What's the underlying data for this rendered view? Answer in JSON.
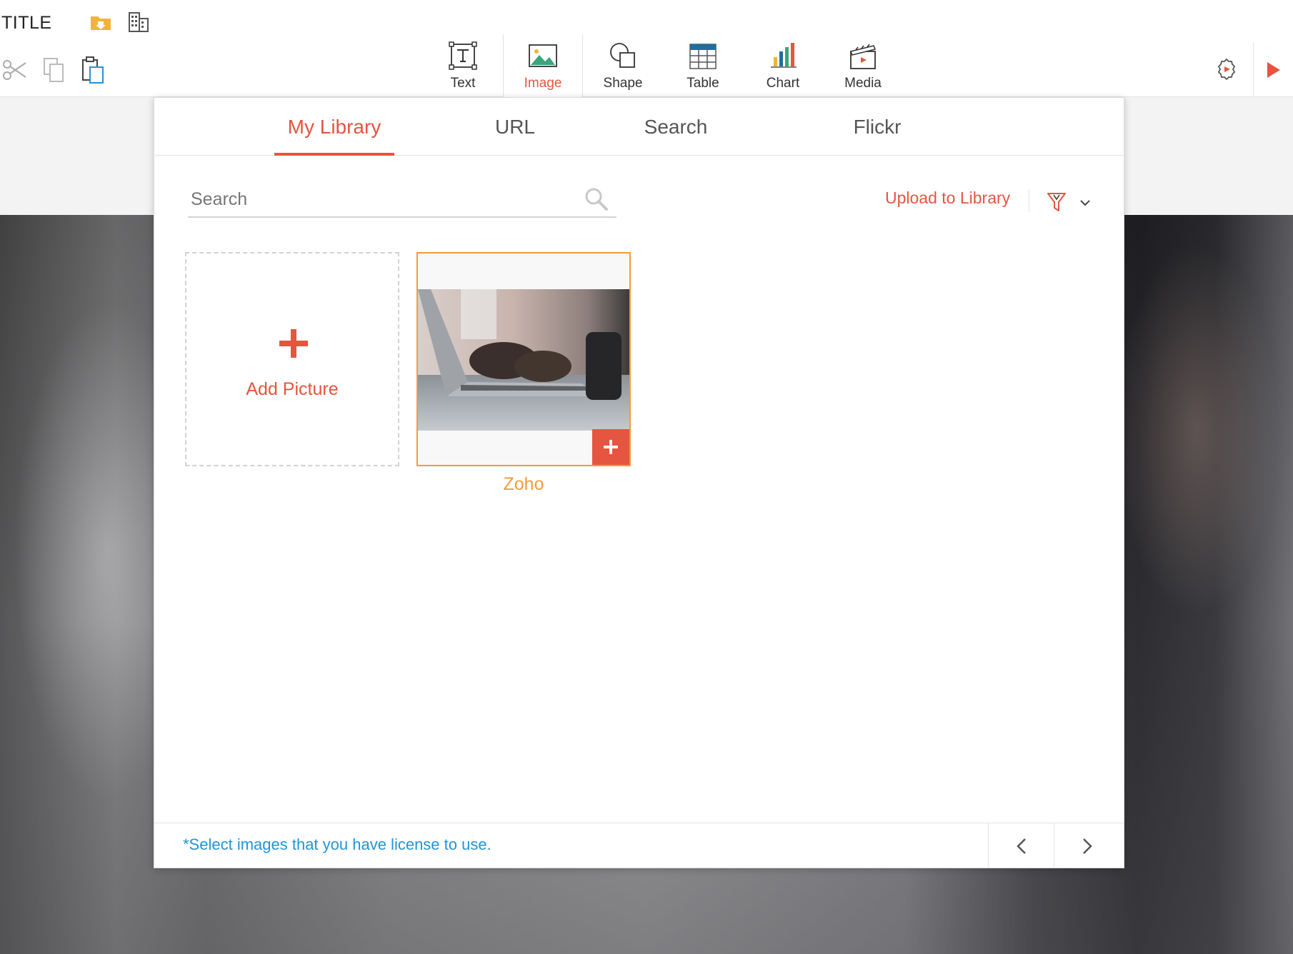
{
  "app": {
    "title": "TITLE"
  },
  "toolbar": {
    "insert": [
      {
        "label": "Text",
        "icon": "text-box-icon"
      },
      {
        "label": "Image",
        "icon": "image-icon",
        "active": true
      },
      {
        "label": "Shape",
        "icon": "shape-icon"
      },
      {
        "label": "Table",
        "icon": "table-icon"
      },
      {
        "label": "Chart",
        "icon": "chart-icon"
      },
      {
        "label": "Media",
        "icon": "media-clapper-icon"
      }
    ],
    "clipboard_icons": [
      "scissors-icon",
      "copy-icon",
      "paste-icon"
    ],
    "right_icons": [
      "settings-gear-icon",
      "play-icon"
    ]
  },
  "dialog": {
    "tabs": [
      {
        "label": "My Library",
        "active": true
      },
      {
        "label": "URL"
      },
      {
        "label": "Search"
      },
      {
        "label": "Flickr"
      }
    ],
    "search": {
      "placeholder": "Search",
      "value": ""
    },
    "upload_label": "Upload to Library",
    "add_tile_label": "Add Picture",
    "images": [
      {
        "name": "Zoho"
      }
    ],
    "footer_note": "*Select images that you have license to use."
  },
  "colors": {
    "accent": "#e5553f",
    "selection": "#f39c3a",
    "link_blue": "#1f95d8"
  }
}
